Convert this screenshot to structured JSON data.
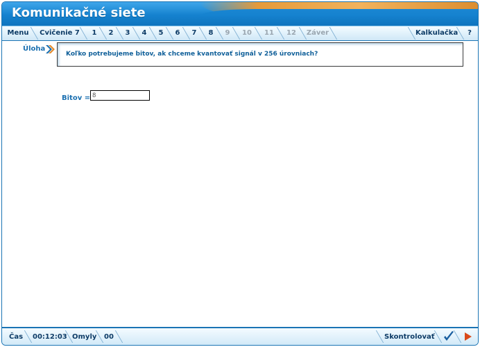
{
  "app": {
    "title": "Komunikačné siete"
  },
  "nav": {
    "menu": "Menu",
    "exercise": "Cvičenie 7",
    "steps": [
      {
        "label": "1",
        "enabled": true
      },
      {
        "label": "2",
        "enabled": true
      },
      {
        "label": "3",
        "enabled": true
      },
      {
        "label": "4",
        "enabled": true
      },
      {
        "label": "5",
        "enabled": true
      },
      {
        "label": "6",
        "enabled": true
      },
      {
        "label": "7",
        "enabled": true
      },
      {
        "label": "8",
        "enabled": true
      },
      {
        "label": "9",
        "enabled": false
      },
      {
        "label": "10",
        "enabled": false
      },
      {
        "label": "11",
        "enabled": false
      },
      {
        "label": "12",
        "enabled": false
      },
      {
        "label": "Záver",
        "enabled": false
      }
    ],
    "calculator": "Kalkulačka",
    "help": "?"
  },
  "task": {
    "label": "Úloha",
    "question": "Koľko potrebujeme bitov, ak chceme kvantovať signál v 256 úrovniach?"
  },
  "answer": {
    "label": "Bitov =",
    "value": "8"
  },
  "status": {
    "time_label": "Čas",
    "time_value": "00:12:03",
    "errors_label": "Omyly",
    "errors_value": "00",
    "check_label": "Skontrolovať"
  },
  "colors": {
    "accent": "#1a74b4",
    "title_orange": "#e59a3a",
    "label_blue": "#1a6fb0",
    "disabled_gray": "#9aa6b0"
  }
}
